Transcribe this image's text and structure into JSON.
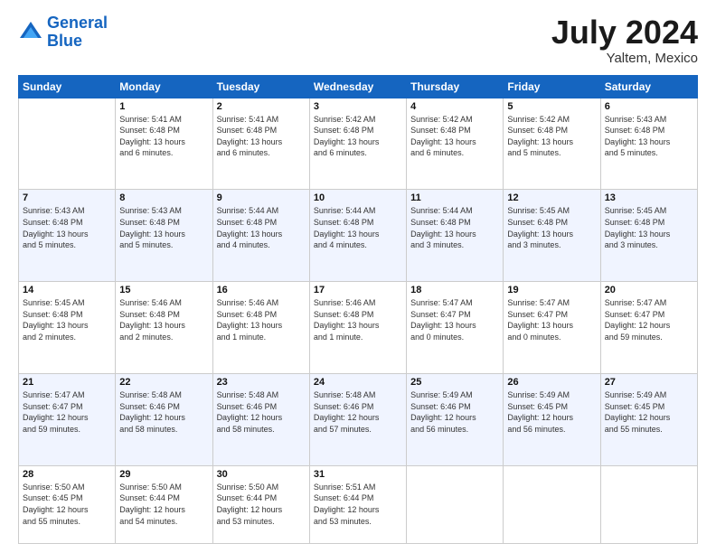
{
  "header": {
    "logo_line1": "General",
    "logo_line2": "Blue",
    "month": "July 2024",
    "location": "Yaltem, Mexico"
  },
  "columns": [
    "Sunday",
    "Monday",
    "Tuesday",
    "Wednesday",
    "Thursday",
    "Friday",
    "Saturday"
  ],
  "weeks": [
    [
      {
        "day": "",
        "info": ""
      },
      {
        "day": "1",
        "info": "Sunrise: 5:41 AM\nSunset: 6:48 PM\nDaylight: 13 hours\nand 6 minutes."
      },
      {
        "day": "2",
        "info": "Sunrise: 5:41 AM\nSunset: 6:48 PM\nDaylight: 13 hours\nand 6 minutes."
      },
      {
        "day": "3",
        "info": "Sunrise: 5:42 AM\nSunset: 6:48 PM\nDaylight: 13 hours\nand 6 minutes."
      },
      {
        "day": "4",
        "info": "Sunrise: 5:42 AM\nSunset: 6:48 PM\nDaylight: 13 hours\nand 6 minutes."
      },
      {
        "day": "5",
        "info": "Sunrise: 5:42 AM\nSunset: 6:48 PM\nDaylight: 13 hours\nand 5 minutes."
      },
      {
        "day": "6",
        "info": "Sunrise: 5:43 AM\nSunset: 6:48 PM\nDaylight: 13 hours\nand 5 minutes."
      }
    ],
    [
      {
        "day": "7",
        "info": "Sunrise: 5:43 AM\nSunset: 6:48 PM\nDaylight: 13 hours\nand 5 minutes."
      },
      {
        "day": "8",
        "info": "Sunrise: 5:43 AM\nSunset: 6:48 PM\nDaylight: 13 hours\nand 5 minutes."
      },
      {
        "day": "9",
        "info": "Sunrise: 5:44 AM\nSunset: 6:48 PM\nDaylight: 13 hours\nand 4 minutes."
      },
      {
        "day": "10",
        "info": "Sunrise: 5:44 AM\nSunset: 6:48 PM\nDaylight: 13 hours\nand 4 minutes."
      },
      {
        "day": "11",
        "info": "Sunrise: 5:44 AM\nSunset: 6:48 PM\nDaylight: 13 hours\nand 3 minutes."
      },
      {
        "day": "12",
        "info": "Sunrise: 5:45 AM\nSunset: 6:48 PM\nDaylight: 13 hours\nand 3 minutes."
      },
      {
        "day": "13",
        "info": "Sunrise: 5:45 AM\nSunset: 6:48 PM\nDaylight: 13 hours\nand 3 minutes."
      }
    ],
    [
      {
        "day": "14",
        "info": "Sunrise: 5:45 AM\nSunset: 6:48 PM\nDaylight: 13 hours\nand 2 minutes."
      },
      {
        "day": "15",
        "info": "Sunrise: 5:46 AM\nSunset: 6:48 PM\nDaylight: 13 hours\nand 2 minutes."
      },
      {
        "day": "16",
        "info": "Sunrise: 5:46 AM\nSunset: 6:48 PM\nDaylight: 13 hours\nand 1 minute."
      },
      {
        "day": "17",
        "info": "Sunrise: 5:46 AM\nSunset: 6:48 PM\nDaylight: 13 hours\nand 1 minute."
      },
      {
        "day": "18",
        "info": "Sunrise: 5:47 AM\nSunset: 6:47 PM\nDaylight: 13 hours\nand 0 minutes."
      },
      {
        "day": "19",
        "info": "Sunrise: 5:47 AM\nSunset: 6:47 PM\nDaylight: 13 hours\nand 0 minutes."
      },
      {
        "day": "20",
        "info": "Sunrise: 5:47 AM\nSunset: 6:47 PM\nDaylight: 12 hours\nand 59 minutes."
      }
    ],
    [
      {
        "day": "21",
        "info": "Sunrise: 5:47 AM\nSunset: 6:47 PM\nDaylight: 12 hours\nand 59 minutes."
      },
      {
        "day": "22",
        "info": "Sunrise: 5:48 AM\nSunset: 6:46 PM\nDaylight: 12 hours\nand 58 minutes."
      },
      {
        "day": "23",
        "info": "Sunrise: 5:48 AM\nSunset: 6:46 PM\nDaylight: 12 hours\nand 58 minutes."
      },
      {
        "day": "24",
        "info": "Sunrise: 5:48 AM\nSunset: 6:46 PM\nDaylight: 12 hours\nand 57 minutes."
      },
      {
        "day": "25",
        "info": "Sunrise: 5:49 AM\nSunset: 6:46 PM\nDaylight: 12 hours\nand 56 minutes."
      },
      {
        "day": "26",
        "info": "Sunrise: 5:49 AM\nSunset: 6:45 PM\nDaylight: 12 hours\nand 56 minutes."
      },
      {
        "day": "27",
        "info": "Sunrise: 5:49 AM\nSunset: 6:45 PM\nDaylight: 12 hours\nand 55 minutes."
      }
    ],
    [
      {
        "day": "28",
        "info": "Sunrise: 5:50 AM\nSunset: 6:45 PM\nDaylight: 12 hours\nand 55 minutes."
      },
      {
        "day": "29",
        "info": "Sunrise: 5:50 AM\nSunset: 6:44 PM\nDaylight: 12 hours\nand 54 minutes."
      },
      {
        "day": "30",
        "info": "Sunrise: 5:50 AM\nSunset: 6:44 PM\nDaylight: 12 hours\nand 53 minutes."
      },
      {
        "day": "31",
        "info": "Sunrise: 5:51 AM\nSunset: 6:44 PM\nDaylight: 12 hours\nand 53 minutes."
      },
      {
        "day": "",
        "info": ""
      },
      {
        "day": "",
        "info": ""
      },
      {
        "day": "",
        "info": ""
      }
    ]
  ]
}
